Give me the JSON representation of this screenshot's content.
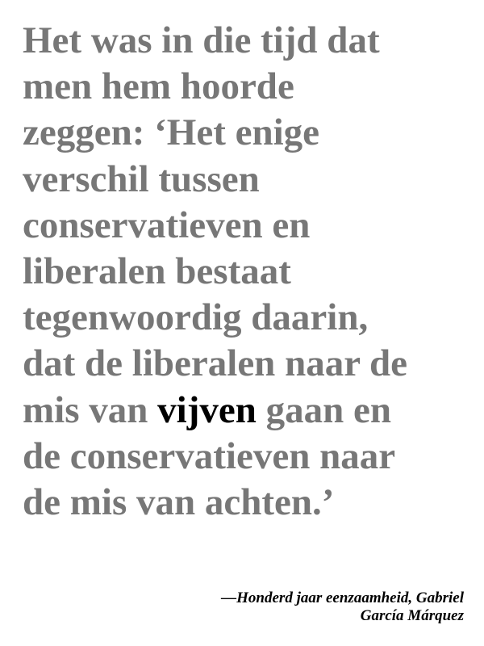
{
  "quote": {
    "lines": [
      "Het was in die tijd dat",
      "men hem hoorde",
      "zeggen: ‘Het enige",
      "verschil tussen",
      "conservatieven en",
      "liberalen bestaat",
      "tegenwoordig daarin,",
      "dat de liberalen naar de",
      "",
      "de conservatieven naar",
      "de mis van achten.’"
    ],
    "highlight_line": {
      "before": "mis van ",
      "highlight": "vijven",
      "after": " gaan en"
    },
    "colors": {
      "text": "#777777",
      "highlight": "#000000"
    }
  },
  "attribution": {
    "line1": "—Honderd jaar eenzaamheid, Gabriel",
    "line2": "García Márquez"
  }
}
